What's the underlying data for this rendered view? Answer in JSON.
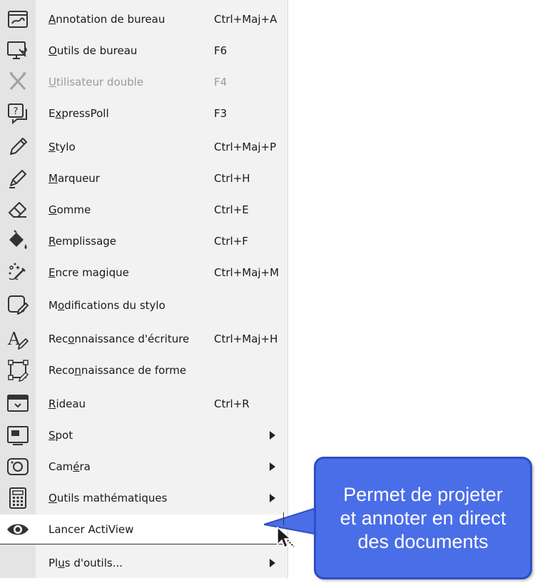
{
  "menu": {
    "items": [
      {
        "label": "Annotation de bureau",
        "mnemonic_index": 0,
        "shortcut": "Ctrl+Maj+A",
        "icon": "desktop-annotation-icon",
        "state": "normal"
      },
      {
        "label": "Outils de bureau",
        "mnemonic_index": 0,
        "shortcut": "F6",
        "icon": "desktop-tools-icon",
        "state": "normal"
      },
      {
        "label": "Utilisateur double",
        "mnemonic_index": 0,
        "shortcut": "F4",
        "icon": "dual-user-icon",
        "state": "disabled"
      },
      {
        "label": "ExpressPoll",
        "mnemonic_index": 1,
        "shortcut": "F3",
        "icon": "expresspoll-icon",
        "state": "normal"
      },
      {
        "label": "Stylo",
        "mnemonic_index": 0,
        "shortcut": "Ctrl+Maj+P",
        "icon": "pen-icon",
        "state": "normal"
      },
      {
        "label": "Marqueur",
        "mnemonic_index": 0,
        "shortcut": "Ctrl+H",
        "icon": "marker-icon",
        "state": "normal"
      },
      {
        "label": "Gomme",
        "mnemonic_index": 0,
        "shortcut": "Ctrl+E",
        "icon": "eraser-icon",
        "state": "normal"
      },
      {
        "label": "Remplissage",
        "mnemonic_index": 0,
        "shortcut": "Ctrl+F",
        "icon": "fill-bucket-icon",
        "state": "normal"
      },
      {
        "label": "Encre magique",
        "mnemonic_index": 0,
        "shortcut": "Ctrl+Maj+M",
        "icon": "magic-ink-icon",
        "state": "normal"
      },
      {
        "label": "Modifications du stylo",
        "mnemonic_index": 1,
        "shortcut": "",
        "icon": "pen-modifiers-icon",
        "state": "normal"
      },
      {
        "label": "Reconnaissance d'écriture",
        "mnemonic_index": 3,
        "shortcut": "Ctrl+Maj+H",
        "icon": "handwriting-recognition-icon",
        "state": "normal"
      },
      {
        "label": "Reconnaissance de forme",
        "mnemonic_index": 4,
        "shortcut": "",
        "icon": "shape-recognition-icon",
        "state": "normal"
      },
      {
        "label": "Rideau",
        "mnemonic_index": 0,
        "shortcut": "Ctrl+R",
        "icon": "curtain-icon",
        "state": "normal"
      },
      {
        "label": "Spot",
        "mnemonic_index": 0,
        "shortcut": "",
        "icon": "spotlight-icon",
        "state": "submenu"
      },
      {
        "label": "Caméra",
        "mnemonic_index": 3,
        "shortcut": "",
        "icon": "camera-icon",
        "state": "submenu"
      },
      {
        "label": "Outils mathématiques",
        "mnemonic_index": 0,
        "shortcut": "",
        "icon": "calculator-icon",
        "state": "submenu"
      },
      {
        "label": "Lancer ActiView",
        "mnemonic_index": -1,
        "shortcut": "",
        "icon": "eye-icon",
        "state": "selected"
      },
      {
        "label": "Plus d'outils...",
        "mnemonic_index": 2,
        "shortcut": "",
        "icon": "",
        "state": "submenu"
      }
    ]
  },
  "callout": {
    "lines": [
      "Permet de projeter",
      "et annoter en direct",
      "des documents"
    ],
    "fill_color": "#4a6ee8",
    "border_color": "#2e4fc4"
  }
}
